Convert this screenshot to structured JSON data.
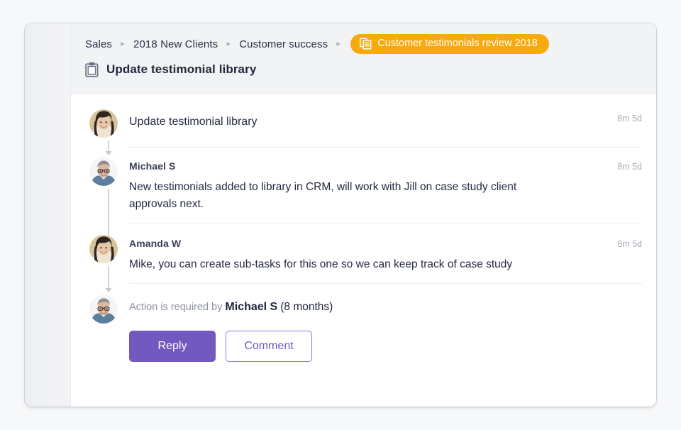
{
  "colors": {
    "accent_purple": "#7259bf",
    "badge_amber": "#f6aa0d",
    "page_bg": "#f7f8f9",
    "header_bg": "#f2f3f5",
    "text_dark": "#242a42",
    "text_muted": "#a7abb8"
  },
  "header": {
    "breadcrumb": [
      {
        "label": "Sales",
        "type": "link"
      },
      {
        "label": "2018 New Clients",
        "type": "link"
      },
      {
        "label": "Customer success",
        "type": "link"
      },
      {
        "label": "Customer testimonials review 2018",
        "type": "badge",
        "icon": "documents-icon"
      }
    ],
    "separator": "▸",
    "title": "Update testimonial library",
    "title_icon": "clipboard-icon"
  },
  "thread": {
    "items": [
      {
        "avatar": "woman-dark-hair",
        "kind": "task",
        "title": "Update testimonial library",
        "timestamp": "8m 5d"
      },
      {
        "avatar": "man-glasses",
        "kind": "comment",
        "author": "Michael S",
        "timestamp": "8m 5d",
        "body": "New testimonials added to library in CRM, will work with Jill on case study client approvals next."
      },
      {
        "avatar": "woman-dark-hair",
        "kind": "comment",
        "author": "Amanda W",
        "timestamp": "8m 5d",
        "body": "Mike, you can create sub-tasks for this one so we can keep track of case study"
      },
      {
        "avatar": "man-glasses",
        "kind": "action",
        "action_prefix": "Action is required by",
        "action_person": "Michael S",
        "action_duration": "(8 months)"
      }
    ]
  },
  "footer": {
    "reply_label": "Reply",
    "comment_label": "Comment"
  }
}
